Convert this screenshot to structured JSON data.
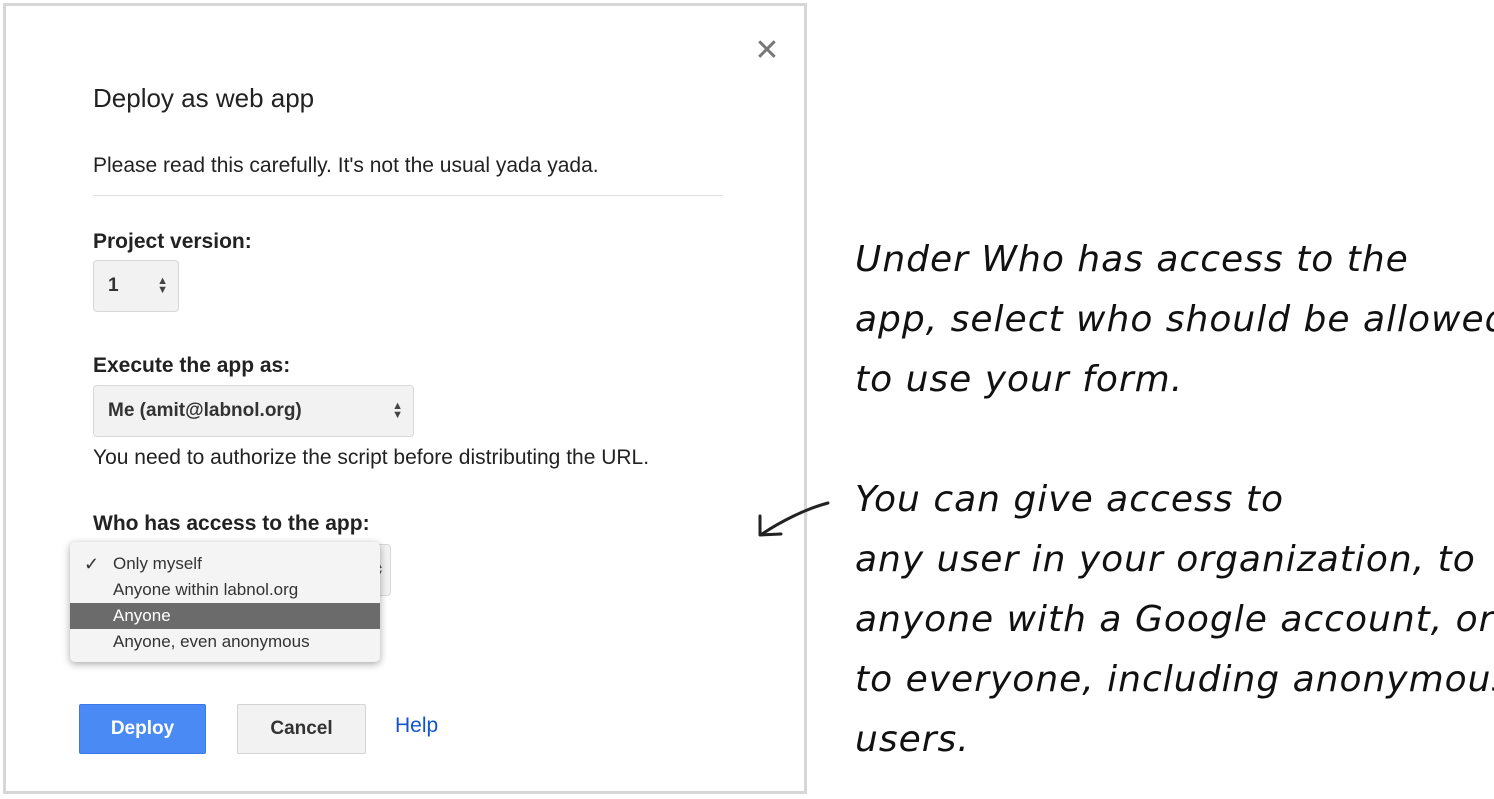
{
  "dialog": {
    "title": "Deploy as web app",
    "intro": "Please read this carefully. It's not the usual yada yada.",
    "close_glyph": "✕",
    "project_version": {
      "label": "Project version:",
      "value": "1"
    },
    "execute_as": {
      "label": "Execute the app as:",
      "value": "Me (amit@labnol.org)",
      "note": "You need to authorize the script before distributing the URL."
    },
    "access": {
      "label": "Who has access to the app:",
      "options": [
        "Only myself",
        "Anyone within labnol.org",
        "Anyone",
        "Anyone, even anonymous"
      ],
      "checked_index": 0,
      "highlighted_index": 2
    },
    "buttons": {
      "deploy": "Deploy",
      "cancel": "Cancel",
      "help": "Help"
    }
  },
  "annotation": {
    "para1": [
      "Under Who has access to the",
      "app, select who should be allowed",
      "to use your form."
    ],
    "para2": [
      "You can give access to",
      "any user in your organization, to",
      "anyone with a Google account, or",
      "to everyone, including anonymous",
      "users."
    ]
  },
  "colors": {
    "primary_button": "#4a8af4",
    "link": "#1155cc",
    "highlight_option": "#6b6b6b"
  },
  "icons": {
    "close": "close-icon",
    "check": "checkmark-icon",
    "select_arrows": "updown-arrows-icon",
    "pointer_arrow": "arrow-icon"
  }
}
